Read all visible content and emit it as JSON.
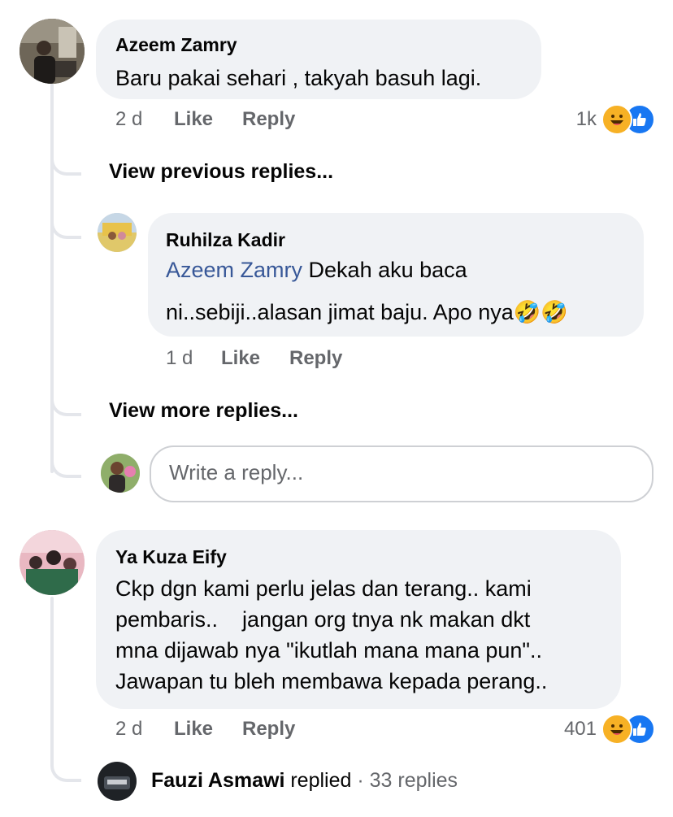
{
  "comments": [
    {
      "author": "Azeem Zamry",
      "text": "Baru pakai sehari , takyah basuh lagi.",
      "time": "2 d",
      "like_label": "Like",
      "reply_label": "Reply",
      "reaction_count": "1k",
      "reaction_icons": [
        "haha-icon",
        "like-icon"
      ]
    },
    {
      "author": "Ya Kuza Eify",
      "lines": [
        "Ckp dgn kami perlu jelas dan terang.. kami",
        "pembaris..    jangan org tnya nk makan dkt",
        "mna dijawab nya \"ikutlah mana mana pun\"..",
        "Jawapan tu bleh membawa kepada perang.."
      ],
      "time": "2 d",
      "like_label": "Like",
      "reply_label": "Reply",
      "reaction_count": "401",
      "reaction_icons": [
        "haha-icon",
        "like-icon"
      ]
    }
  ],
  "view_previous": "View previous replies...",
  "view_more": "View more replies...",
  "reply": {
    "author": "Ruhilza Kadir",
    "mention": "Azeem Zamry",
    "line1_rest": "Dekah aku baca",
    "line2": "ni..sebiji..alasan jimat baju. Apo nya",
    "emoji": "🤣🤣",
    "time": "1 d",
    "like_label": "Like",
    "reply_label": "Reply"
  },
  "write_reply": {
    "placeholder": "Write a reply..."
  },
  "collapsed": {
    "author": "Fauzi Asmawi",
    "replied": "replied",
    "separator": "·",
    "count": "33 replies"
  },
  "colors": {
    "link": "#385898",
    "meta": "#65676b",
    "bubble": "#f0f2f5",
    "like_blue": "#1877f2",
    "haha_yellow": "#f7b125"
  }
}
